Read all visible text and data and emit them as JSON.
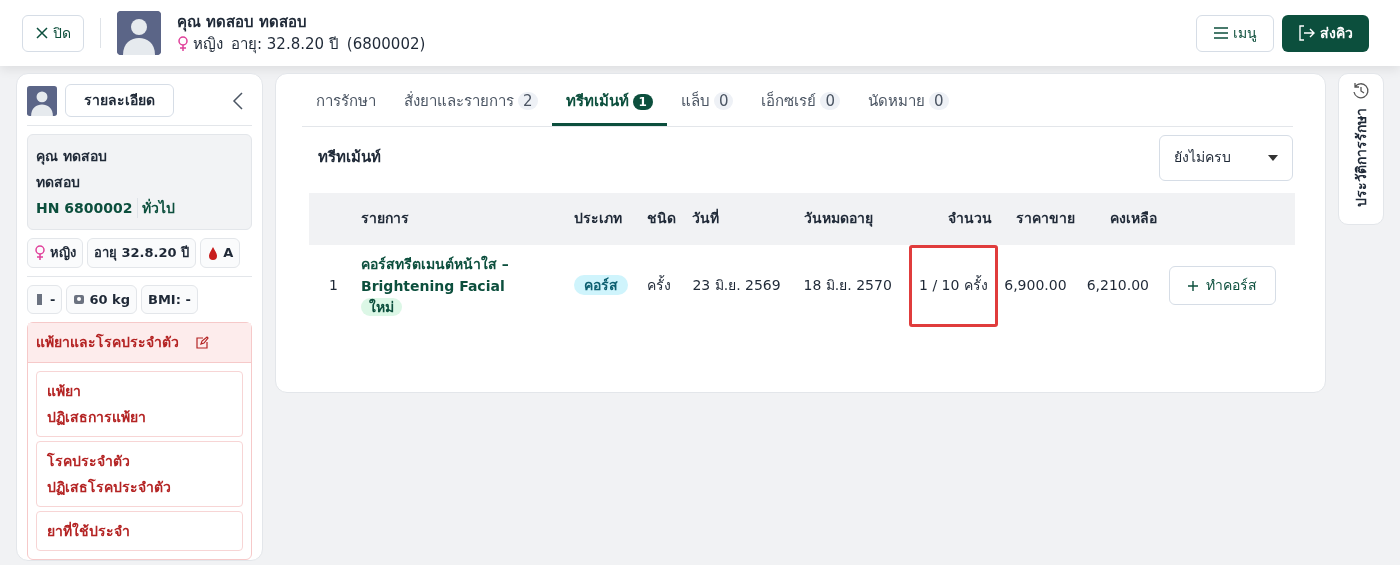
{
  "header": {
    "close_button": "ปิด",
    "patient_name": "คุณ ทดสอบ ทดสอบ",
    "gender": "หญิง",
    "age": "อายุ: 32.8.20 ปี",
    "patient_id": "(6800002)",
    "menu_button": "เมนู",
    "send_queue_button": "ส่งคิว"
  },
  "sidebar": {
    "details_button": "รายละเอียด",
    "name_line_1": "คุณ ทดสอบ",
    "name_line_2": "ทดสอบ",
    "hn": "HN 6800002",
    "patient_type": "ทั่วไป",
    "chips": [
      {
        "kind": "gender",
        "text": "หญิง"
      },
      {
        "kind": "plain",
        "text": "อายุ 32.8.20 ปี"
      },
      {
        "kind": "blood",
        "text": "A"
      }
    ],
    "measures": [
      {
        "kind": "height",
        "text": "-"
      },
      {
        "kind": "weight",
        "text": "60 kg"
      },
      {
        "kind": "plain",
        "text": "BMI: -"
      }
    ],
    "allergy_panel": {
      "title": "แพ้ยาและโรคประจำตัว",
      "cards": [
        {
          "title": "แพ้ยา",
          "value": "ปฏิเสธการแพ้ยา"
        },
        {
          "title": "โรคประจำตัว",
          "value": "ปฏิเสธโรคประจำตัว"
        },
        {
          "title": "ยาที่ใช้ประจำ"
        }
      ]
    }
  },
  "tabs": [
    {
      "label": "การรักษา",
      "selected": false
    },
    {
      "label": "สั่งยาและรายการ",
      "count": "2",
      "selected": false
    },
    {
      "label": "ทรีทเม้นท์",
      "count": "1",
      "selected": true
    },
    {
      "label": "แล็บ",
      "count": "0",
      "selected": false
    },
    {
      "label": "เอ็กซเรย์",
      "count": "0",
      "selected": false
    },
    {
      "label": "นัดหมาย",
      "count": "0",
      "selected": false
    }
  ],
  "section_title": "ทรีทเม้นท์",
  "filter_select": "ยังไม่ครบ",
  "table": {
    "columns": [
      "",
      "รายการ",
      "ประเภท",
      "ชนิด",
      "วันที่",
      "วันหมดอายุ",
      "จำนวน",
      "ราคาขาย",
      "คงเหลือ",
      ""
    ],
    "rows": [
      {
        "number": "1",
        "name": "คอร์สทรีตเมนต์หน้าใส – Brightening Facial",
        "tag": "ใหม่",
        "type": "คอร์ส",
        "unit": "ครั้ง",
        "date": "23 มิ.ย. 2569",
        "expiry": "18 มิ.ย. 2570",
        "quantity": "1 / 10 ครั้ง",
        "quantity_highlighted": true,
        "price": "6,900.00",
        "remaining": "6,210.00",
        "action": "ทำคอร์ส"
      }
    ]
  },
  "history_tab": "ประวัติการรักษา"
}
